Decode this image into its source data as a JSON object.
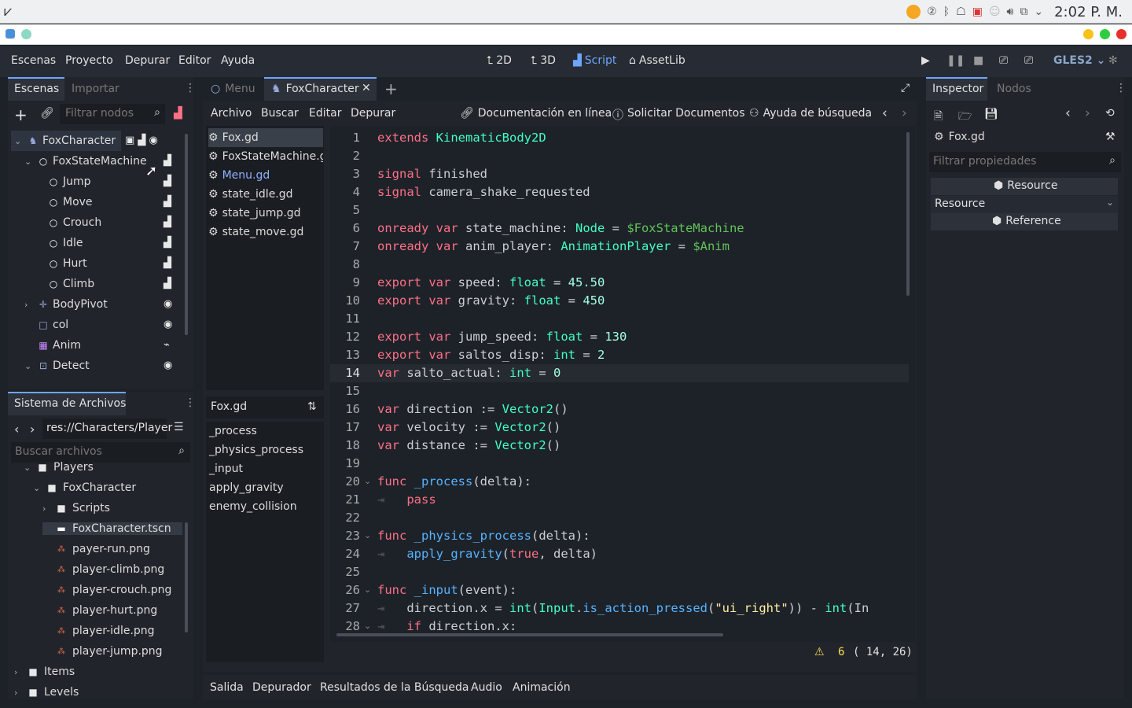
{
  "os": {
    "clock": "2:02 P. M.",
    "tray_icons": [
      "sun-icon",
      "help-icon",
      "bluetooth-icon",
      "ghost-icon",
      "display-icon",
      "user-icon",
      "volume-icon",
      "clipboard-icon",
      "chevron-down-icon"
    ]
  },
  "menu": {
    "items": [
      "Escenas",
      "Proyecto",
      "Depurar",
      "Editor",
      "Ayuda"
    ],
    "workspaces": [
      "2D",
      "3D",
      "Script",
      "AssetLib"
    ],
    "renderer": "GLES2"
  },
  "scene_panel": {
    "tabs": [
      "Escenas",
      "Importar"
    ],
    "filter_placeholder": "Filtrar nodos",
    "nodes": [
      {
        "label": "FoxCharacter",
        "depth": 0,
        "icon": "kinematic-icon",
        "expander": "v"
      },
      {
        "label": "FoxStateMachine",
        "depth": 1,
        "icon": "node-icon",
        "expander": "v"
      },
      {
        "label": "Jump",
        "depth": 2,
        "icon": "node-icon",
        "expander": ""
      },
      {
        "label": "Move",
        "depth": 2,
        "icon": "node-icon",
        "expander": ""
      },
      {
        "label": "Crouch",
        "depth": 2,
        "icon": "node-icon",
        "expander": ""
      },
      {
        "label": "Idle",
        "depth": 2,
        "icon": "node-icon",
        "expander": ""
      },
      {
        "label": "Hurt",
        "depth": 2,
        "icon": "node-icon",
        "expander": ""
      },
      {
        "label": "Climb",
        "depth": 2,
        "icon": "node-icon",
        "expander": ""
      },
      {
        "label": "BodyPivot",
        "depth": 1,
        "icon": "position-icon",
        "expander": ">"
      },
      {
        "label": "col",
        "depth": 1,
        "icon": "collision-icon",
        "expander": ""
      },
      {
        "label": "Anim",
        "depth": 1,
        "icon": "animation-icon",
        "expander": ""
      },
      {
        "label": "Detect",
        "depth": 1,
        "icon": "area-icon",
        "expander": "v"
      }
    ]
  },
  "filesystem": {
    "title": "Sistema de Archivos",
    "path": "res://Characters/Player",
    "search_placeholder": "Buscar archivos",
    "items": [
      {
        "label": "Players",
        "depth": 1,
        "kind": "folder",
        "expander": "v"
      },
      {
        "label": "FoxCharacter",
        "depth": 2,
        "kind": "folder",
        "expander": "v"
      },
      {
        "label": "Scripts",
        "depth": 3,
        "kind": "folder",
        "expander": ">"
      },
      {
        "label": "FoxCharacter.tscn",
        "depth": 3,
        "kind": "scene",
        "expander": ""
      },
      {
        "label": "payer-run.png",
        "depth": 3,
        "kind": "image",
        "expander": ""
      },
      {
        "label": "player-climb.png",
        "depth": 3,
        "kind": "image",
        "expander": ""
      },
      {
        "label": "player-crouch.png",
        "depth": 3,
        "kind": "image",
        "expander": ""
      },
      {
        "label": "player-hurt.png",
        "depth": 3,
        "kind": "image",
        "expander": ""
      },
      {
        "label": "player-idle.png",
        "depth": 3,
        "kind": "image",
        "expander": ""
      },
      {
        "label": "player-jump.png",
        "depth": 3,
        "kind": "image",
        "expander": ""
      },
      {
        "label": "Items",
        "depth": 0,
        "kind": "folder",
        "expander": ">"
      },
      {
        "label": "Levels",
        "depth": 0,
        "kind": "folder",
        "expander": ">"
      }
    ]
  },
  "editor_tabs": [
    "Menu",
    "FoxCharacter"
  ],
  "script_menu": [
    "Archivo",
    "Buscar",
    "Editar",
    "Depurar"
  ],
  "script_help": [
    "Documentación en línea",
    "Solicitar Documentos",
    "Ayuda de búsqueda"
  ],
  "script_files": [
    "Fox.gd",
    "FoxStateMachine.gd",
    "Menu.gd",
    "state_idle.gd",
    "state_jump.gd",
    "state_move.gd"
  ],
  "method_filter": "Fox.gd",
  "methods": [
    "_process",
    "_physics_process",
    "_input",
    "apply_gravity",
    "enemy_collision"
  ],
  "code_lines": [
    "extends KinematicBody2D",
    "",
    "signal finished",
    "signal camera_shake_requested",
    "",
    "onready var state_machine: Node = $FoxStateMachine",
    "onready var anim_player: AnimationPlayer = $Anim",
    "",
    "export var speed: float = 45.50",
    "export var gravity: float = 450",
    "",
    "export var jump_speed: float = 130",
    "export var saltos_disp: int = 2",
    "var salto_actual: int = 0",
    "",
    "var direction := Vector2()",
    "var velocity := Vector2()",
    "var distance := Vector2()",
    "",
    "func _process(delta):",
    "    pass",
    "",
    "func _physics_process(delta):",
    "    apply_gravity(true, delta)",
    "",
    "func _input(event):",
    "    direction.x = int(Input.is_action_pressed(\"ui_right\")) - int(In",
    "    if direction.x:"
  ],
  "status": {
    "warnings": "6",
    "position": "( 14, 26)"
  },
  "bottom_tabs": [
    "Salida",
    "Depurador",
    "Resultados de la Búsqueda",
    "Audio",
    "Animación"
  ],
  "inspector": {
    "tabs": [
      "Inspector",
      "Nodos"
    ],
    "object": "Fox.gd",
    "filter_placeholder": "Filtrar propiedades",
    "section": "Resource",
    "category": "Resource",
    "subsection": "Reference"
  }
}
